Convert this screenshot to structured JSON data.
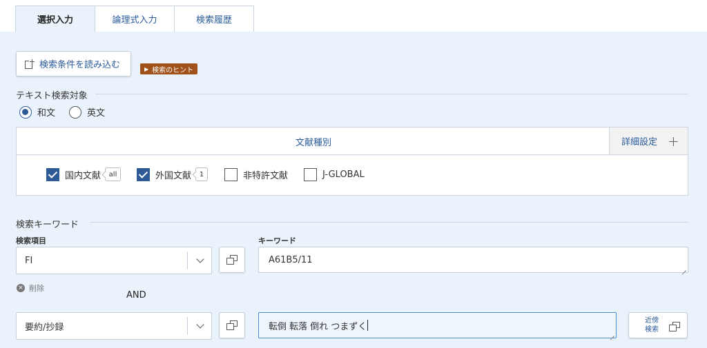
{
  "tabs": [
    {
      "label": "選択入力",
      "active": true
    },
    {
      "label": "論理式入力",
      "active": false
    },
    {
      "label": "検索履歴",
      "active": false
    }
  ],
  "load_button": {
    "label": "検索条件を読み込む"
  },
  "hint": {
    "label": "検索のヒント"
  },
  "text_target": {
    "title": "テキスト検索対象",
    "options": [
      {
        "label": "和文",
        "checked": true
      },
      {
        "label": "英文",
        "checked": false
      }
    ]
  },
  "doc_type": {
    "title": "文献種別",
    "detail_label": "詳細設定",
    "items": [
      {
        "label": "国内文献",
        "checked": true,
        "badge": "all"
      },
      {
        "label": "外国文献",
        "checked": true,
        "badge": "1"
      },
      {
        "label": "非特許文献",
        "checked": false
      },
      {
        "label": "J-GLOBAL",
        "checked": false
      }
    ]
  },
  "keywords": {
    "title": "検索キーワード",
    "field_header": "検索項目",
    "keyword_header": "キーワード",
    "rows": [
      {
        "field": "FI",
        "keyword": "A61B5/11"
      },
      {
        "field": "要約/抄録",
        "keyword": "転倒 転落 倒れ つまずく"
      }
    ],
    "delete_label": "削除",
    "operator": "AND",
    "near_label_1": "近傍",
    "near_label_2": "検索"
  },
  "colors": {
    "accent": "#2d5a97",
    "panel": "#eaf3fb",
    "hint": "#a0521a"
  }
}
